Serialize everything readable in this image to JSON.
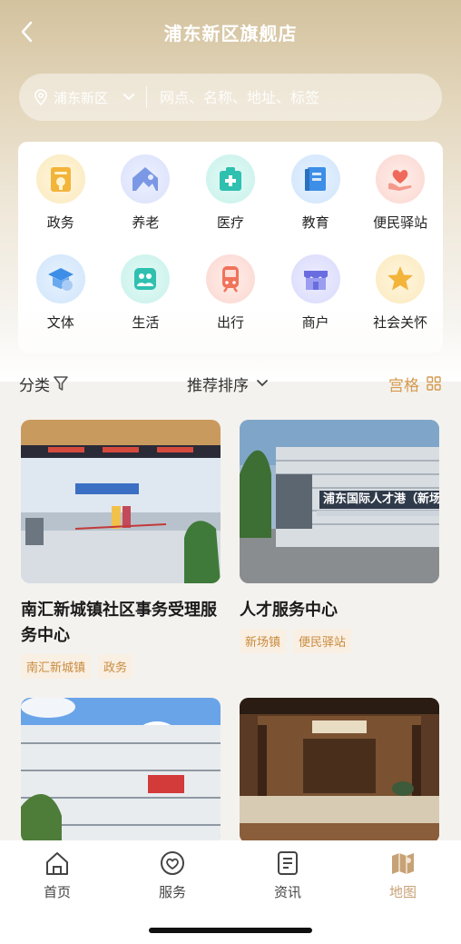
{
  "header": {
    "title": "浦东新区旗舰店"
  },
  "search": {
    "location": "浦东新区",
    "placeholder": "网点、名称、地址、标签"
  },
  "categories": [
    {
      "label": "政务",
      "icon": "government-icon",
      "color": "#f3b43a"
    },
    {
      "label": "养老",
      "icon": "elderly-care-icon",
      "color": "#6d8de0"
    },
    {
      "label": "医疗",
      "icon": "medical-icon",
      "color": "#2fc0b0"
    },
    {
      "label": "教育",
      "icon": "education-icon",
      "color": "#3d8ee6"
    },
    {
      "label": "便民驿站",
      "icon": "heart-hand-icon",
      "color": "#ef6a5a"
    },
    {
      "label": "文体",
      "icon": "culture-sports-icon",
      "color": "#3d8ee6"
    },
    {
      "label": "生活",
      "icon": "life-icon",
      "color": "#2fc0b0"
    },
    {
      "label": "出行",
      "icon": "train-icon",
      "color": "#f0735b"
    },
    {
      "label": "商户",
      "icon": "shop-icon",
      "color": "#6a6de0"
    },
    {
      "label": "社会关怀",
      "icon": "star-icon",
      "color": "#f3b43a"
    }
  ],
  "filter": {
    "category": "分类",
    "sort": "推荐排序",
    "view": "宫格"
  },
  "cards": [
    {
      "name": "南汇新城镇社区事务受理服务中心",
      "tags": [
        "南汇新城镇",
        "政务"
      ]
    },
    {
      "name": "人才服务中心",
      "tags": [
        "新场镇",
        "便民驿站"
      ],
      "sign_text": "浦东国际人才港（新场"
    },
    {
      "name": "",
      "tags": []
    },
    {
      "name": "",
      "tags": []
    }
  ],
  "tabs": [
    {
      "label": "首页",
      "icon": "home-icon"
    },
    {
      "label": "服务",
      "icon": "heart-icon"
    },
    {
      "label": "资讯",
      "icon": "news-icon"
    },
    {
      "label": "地图",
      "icon": "map-icon",
      "active": true
    }
  ],
  "colors": {
    "accent": "#c7a276",
    "tag_bg": "#f9efe3",
    "tag_text": "#c98b3e"
  }
}
